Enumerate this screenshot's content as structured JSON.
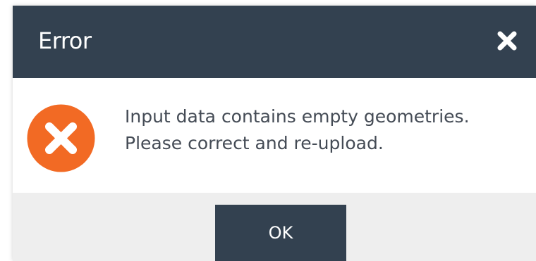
{
  "dialog": {
    "title": "Error",
    "close_icon": "close-icon",
    "status_icon": "error-icon",
    "message_line1": "Input data contains empty geometries.",
    "message_line2": "Please correct and re-upload.",
    "ok_label": "OK"
  },
  "colors": {
    "title_bar": "#334150",
    "title_text": "#ffffff",
    "error_icon": "#f26a24",
    "message_text": "#444b55",
    "footer_bg": "#eeeeee",
    "button_bg": "#334150"
  }
}
